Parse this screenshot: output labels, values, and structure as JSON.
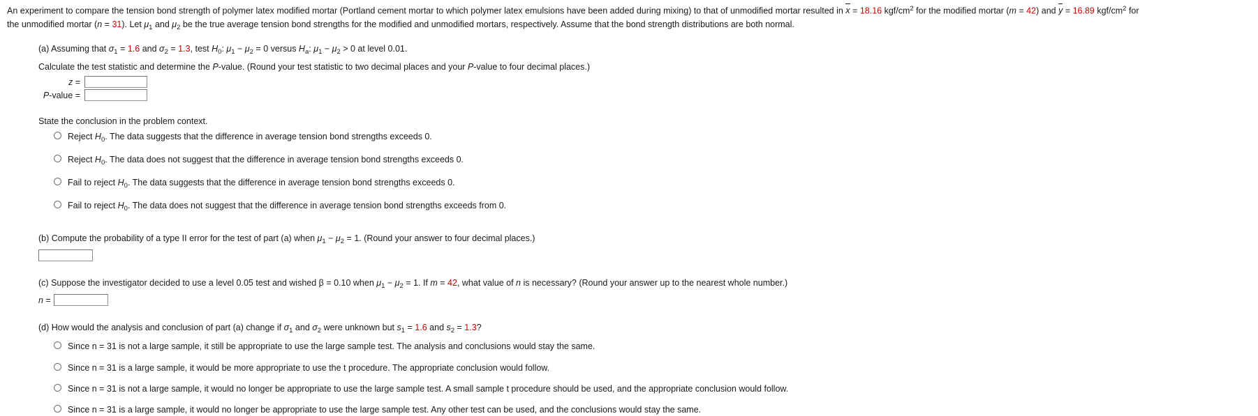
{
  "problem": {
    "intro_part1": "An experiment to compare the tension bond strength of polymer latex modified mortar (Portland cement mortar to which polymer latex emulsions have been added during mixing) to that of unmodified mortar resulted in ",
    "xbar_symbol": "x",
    "xbar_value": "18.16",
    "units": "kgf/cm",
    "units_exp": "2",
    "intro_mid": " for the modified mortar (",
    "m_symbol": "m",
    "m_value": "42",
    "intro_and": ") and ",
    "ybar_symbol": "y",
    "ybar_value": "16.89",
    "intro_for": " for ",
    "line2_pre": "the unmodified mortar (",
    "n_symbol": "n",
    "n_value": "31",
    "line2_post": "). Let ",
    "mu1": "μ",
    "mu2": "μ",
    "line2_tail": " be the true average tension bond strengths for the modified and unmodified mortars, respectively. Assume that the bond strength distributions are both normal."
  },
  "part_a": {
    "label": "(a)",
    "sigma1_value": "1.6",
    "sigma2_value": "1.3",
    "level": "0.01",
    "instruction": "Calculate the test statistic and determine the P-value. (Round your test statistic to two decimal places and your P-value to four decimal places.)",
    "z_label": "z",
    "z_equals": "=",
    "z_value": "",
    "z_placeholder": "",
    "pvalue_label": "P-value",
    "pvalue_equals": "=",
    "pvalue_value": "",
    "pvalue_placeholder": "",
    "conclusion_prompt": "State the conclusion in the problem context.",
    "options": [
      {
        "pre": "Reject ",
        "h": "H",
        "sub": "0",
        "post": ". The data suggests that the difference in average tension bond strengths exceeds 0."
      },
      {
        "pre": "Reject ",
        "h": "H",
        "sub": "0",
        "post": ". The data does not suggest that the difference in average tension bond strengths exceeds 0."
      },
      {
        "pre": "Fail to reject ",
        "h": "H",
        "sub": "0",
        "post": ". The data suggests that the difference in average tension bond strengths exceeds 0."
      },
      {
        "pre": "Fail to reject ",
        "h": "H",
        "sub": "0",
        "post": ". The data does not suggest that the difference in average tension bond strengths exceeds from 0."
      }
    ]
  },
  "part_b": {
    "label": "(b)",
    "text_pre": "Compute the probability of a type II error for the test of part (a) when ",
    "text_post": " = 1. (Round your answer to four decimal places.)",
    "answer_value": "",
    "answer_placeholder": ""
  },
  "part_c": {
    "label": "(c)",
    "text_pre": "Suppose the investigator decided to use a level 0.05 test and wished β = 0.10 when ",
    "text_mid": " = 1. If ",
    "m_symbol": "m",
    "m_value": "42",
    "text_post": ", what value of n is necessary? (Round your answer up to the nearest whole number.)",
    "n_label": "n",
    "n_equals": "=",
    "n_value": "",
    "n_placeholder": ""
  },
  "part_d": {
    "label": "(d)",
    "text_pre": "How would the analysis and conclusion of part (a) change if σ",
    "text_mid": " and σ",
    "text_post": " were unknown but ",
    "s1_value": "1.6",
    "s2_value": "1.3",
    "options": [
      "Since n = 31 is not a large sample, it still be appropriate to use the large sample test. The analysis and conclusions would stay the same.",
      "Since n = 31 is a large sample, it would be more appropriate to use the t procedure. The appropriate conclusion would follow.",
      "Since n = 31 is not a large sample, it would no longer be appropriate to use the large sample test. A small sample t procedure should be used, and the appropriate conclusion would follow.",
      "Since n = 31 is a large sample, it would no longer be appropriate to use the large sample test. Any other test can be used, and the conclusions would stay the same."
    ]
  },
  "colors": {
    "highlight": "#cc0000",
    "text": "#1a1a1a",
    "field_border": "#8f8f8f"
  }
}
